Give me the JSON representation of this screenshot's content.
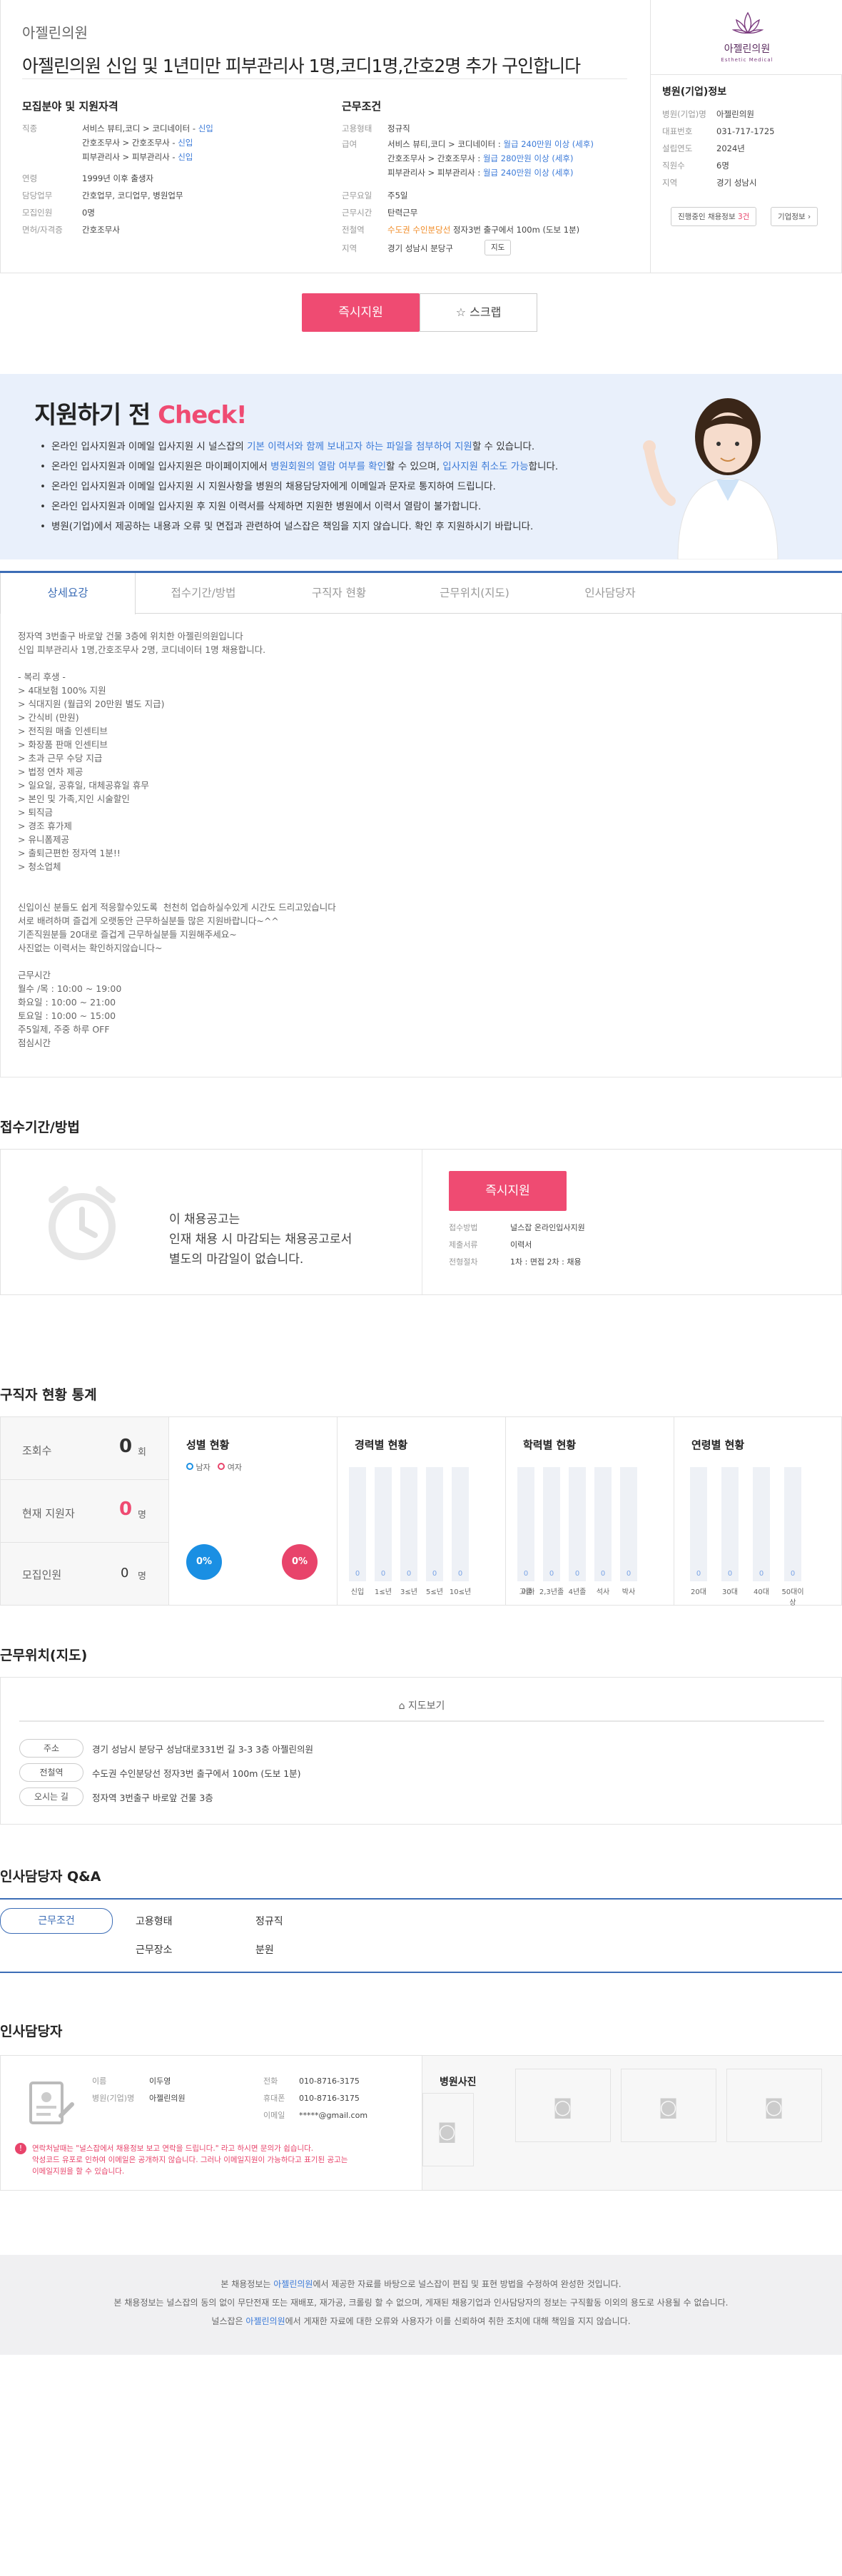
{
  "header": {
    "clinic": "아젤린의원",
    "title": "아젤린의원 신입 및 1년미만 피부관리사 1명,코디1명,간호2명 추가 구인합니다",
    "recruit_title": "모집분야 및 지원자격",
    "job_label": "직종",
    "job_lines": [
      {
        "text": "서비스 뷰티,코디 > 코디네이터 - ",
        "tag": "신입"
      },
      {
        "text": "간호조무사 > 간호조무사 - ",
        "tag": "신입"
      },
      {
        "text": "피부관리사 > 피부관리사 - ",
        "tag": "신입"
      }
    ],
    "age_label": "연령",
    "age_value": "1999년 이후 출생자",
    "duty_label": "담당업무",
    "duty_value": "간호업무, 코디업무, 병원업무",
    "count_label": "모집인원",
    "count_value": "0명",
    "license_label": "면허/자격증",
    "license_value": "간호조무사",
    "cond_title": "근무조건",
    "emp_label": "고용형태",
    "emp_value": "정규직",
    "pay_label": "급여",
    "pay_lines": [
      {
        "text": "서비스 뷰티,코디 > 코디네이터 : ",
        "amt": "월급 240만원 이상 (세후)"
      },
      {
        "text": "간호조무사 > 간호조무사 : ",
        "amt": "월급 280만원 이상 (세후)"
      },
      {
        "text": "피부관리사 > 피부관리사 : ",
        "amt": "월급 240만원 이상 (세후)"
      }
    ],
    "days_label": "근무요일",
    "days_value": "주5일",
    "hours_label": "근무시간",
    "hours_value": "탄력근무",
    "subway_label": "전철역",
    "subway_line": "수도권 수인분당선",
    "subway_value": "정자3번 출구에서 100m (도보 1분)",
    "area_label": "지역",
    "area_value": "경기 성남시 분당구",
    "map_btn": "지도"
  },
  "hospital": {
    "logo_text": "아젤린의원",
    "logo_sub": "Esthetic Medical",
    "title": "병원(기업)정보",
    "rows": [
      {
        "k": "병원(기업)명",
        "v": "아젤린의원"
      },
      {
        "k": "대표번호",
        "v": "031-717-1725"
      },
      {
        "k": "설립연도",
        "v": "2024년"
      },
      {
        "k": "직원수",
        "v": "6명"
      },
      {
        "k": "지역",
        "v": "경기 성남시"
      }
    ],
    "ongoing_prefix": "진행중인 채용정보 ",
    "ongoing_count": "3건",
    "info_btn": "기업정보 ›"
  },
  "actions": {
    "apply": "즉시지원",
    "scrap": "스크랩"
  },
  "banner": {
    "title1": "지원하기 전 ",
    "title2": "Check!",
    "items": [
      {
        "a": "온라인 입사지원과 이메일 입사지원 시 널스잡의 ",
        "b": "기본 이력서와 함께 보내고자 하는 파일을 첨부하여 지원",
        "c": "할 수 있습니다."
      },
      {
        "a": "온라인 입사지원과 이메일 입사지원은 마이페이지에서 ",
        "b": "병원회원의 열람 여부를 확인",
        "c": "할 수 있으며, ",
        "d": "입사지원 취소도 가능",
        "e": "합니다."
      },
      {
        "a": "온라인 입사지원과 이메일 입사지원 시 지원사항을 병원의 채용담당자에게 이메일과 문자로 통지하여 드립니다.",
        "b": "",
        "c": ""
      },
      {
        "a": "온라인 입사지원과 이메일 입사지원 후 지원 이력서를 삭제하면 지원한 병원에서 이력서 열람이 불가합니다.",
        "b": "",
        "c": ""
      },
      {
        "a": "병원(기업)에서 제공하는 내용과 오류 및 면접과 관련하여 널스잡은 책임을 지지 않습니다. 확인 후 지원하시기 바랍니다.",
        "b": "",
        "c": ""
      }
    ]
  },
  "tabs": [
    "상세요강",
    "접수기간/방법",
    "구직자 현황",
    "근무위치(지도)",
    "인사담당자"
  ],
  "detail_text": "정자역 3번출구 바로앞 건물 3층에 위치한 아젤린의원입니다\n신입 피부관리사 1명,간호조무사 2명, 코디네이터 1명 채용합니다.\n\n- 복리 후생 -\n> 4대보험 100% 지원\n> 식대지원 (월급외 20만원 별도 지급)\n> 간식비 (만원)\n> 전직원 매출 인센티브\n> 화장품 판매 인센티브\n> 초과 근무 수당 지급\n> 법정 연차 제공\n> 일요일, 공휴일, 대체공휴일 휴무\n> 본인 및 가족,지인 시술할인\n> 퇴직금\n> 경조 휴가제\n> 유니폼제공\n> 출퇴근편한 정자역 1분!!\n> 청소업체\n\n\n신입이신 분들도 쉽게 적응할수있도록  천천히 업습하실수있게 시간도 드리고있습니다\n서로 배려하며 즐겁게 오랫동안 근무하실분들 많은 지원바랍니다~^^\n기존직원분들 20대로 즐겁게 근무하실분들 지원해주세요~\n사진없는 이력서는 확인하지않습니다~\n\n근무시간\n월수 /목 : 10:00 ~ 19:00\n화요일 : 10:00 ~ 21:00\n토요일 : 10:00 ~ 15:00\n주5일제, 주중 하루 OFF\n점심시간",
  "reception": {
    "title": "접수기간/방법",
    "msg1": "이 채용공고는",
    "msg2": "인재 채용 시 마감되는 채용공고로서",
    "msg3": "별도의 마감일이 없습니다.",
    "apply": "즉시지원",
    "rows": [
      {
        "k": "접수방법",
        "v": "널스잡 온라인입사지원"
      },
      {
        "k": "제출서류",
        "v": "이력서"
      },
      {
        "k": "전형절차",
        "v": "1차 : 면접   2차 : 채용"
      }
    ]
  },
  "stats": {
    "title": "구직자 현황 통계",
    "views_label": "조회수",
    "views": "0",
    "views_unit": "회",
    "applicants_label": "현재 지원자",
    "applicants": "0",
    "applicants_unit": "명",
    "recruit_label": "모집인원",
    "recruit": "0",
    "recruit_unit": "명",
    "gender_title": "성별 현황",
    "male": "남자",
    "female": "여자",
    "male_pct": "0%",
    "female_pct": "0%",
    "career_title": "경력별 현황",
    "career_labels": [
      "신입",
      "1≤년",
      "3≤년",
      "5≤년",
      "10≤년"
    ],
    "career_values": [
      "0",
      "0",
      "0",
      "0",
      "0"
    ],
    "edu_title": "학력별 현황",
    "edu_labels": [
      "고졸",
      "2,3년졸",
      "4년졸",
      "석사",
      "박사"
    ],
    "edu_values": [
      "0",
      "0",
      "0",
      "0",
      "0"
    ],
    "edu_sub": "이하",
    "age_title": "연령별 현황",
    "age_labels": [
      "20대",
      "30대",
      "40대",
      "50대이상"
    ],
    "age_values": [
      "0",
      "0",
      "0",
      "0"
    ]
  },
  "location": {
    "title": "근무위치(지도)",
    "map_btn": "지도보기",
    "rows": [
      {
        "k": "주소",
        "v": "경기 성남시 분당구 성남대로331번 길 3-3 3층 아젤린의원"
      },
      {
        "k": "전철역",
        "v": "수도권 수인분당선 정자3번 출구에서 100m (도보 1분)"
      },
      {
        "k": "오시는 길",
        "v": "정자역 3번출구 바로앞 건물 3층"
      }
    ]
  },
  "qa": {
    "title": "인사담당자 Q&A",
    "tabs": [
      "근무조건",
      "고용형태",
      "정규직",
      "근무장소",
      "분원"
    ]
  },
  "manager": {
    "title": "인사담당자",
    "rows_l": [
      {
        "k": "이름",
        "v": "이두영"
      },
      {
        "k": "병원(기업)명",
        "v": "아젤린의원"
      }
    ],
    "rows_r": [
      {
        "k": "전화",
        "v": "010-8716-3175"
      },
      {
        "k": "휴대폰",
        "v": "010-8716-3175"
      },
      {
        "k": "이메일",
        "v": "*****@gmail.com"
      }
    ],
    "warn1": "연락처날때는 \"널스잡에서 채용정보 보고 연락을 드립니다.\" 라고 하시면 문의가 쉽습니다.",
    "warn2": "악성코드 유포로 인하여 이메일은 공개하지 않습니다. 그러나 이메일지원이 가능하다고 표기된 공고는",
    "warn3": "이메일지원을 할 수 있습니다.",
    "photo_title": "병원사진"
  },
  "footer": {
    "l1a": "본 채용정보는 ",
    "l1b": "아젤린의원",
    "l1c": "에서 제공한 자료를 바탕으로 널스잡이 편집 및 표현 방법을 수정하여 완성한 것입니다.",
    "l2": "본 채용정보는 널스잡의 동의 없이 무단전재 또는 재배포, 재가공, 크롤링 할 수 없으며, 게재된 채용기업과 인사담당자의 정보는 구직활동 이외의 용도로 사용될 수 없습니다.",
    "l3a": "널스잡은 ",
    "l3b": "아젤린의원",
    "l3c": "에서 게재한 자료에 대한 오류와 사용자가 이를 신뢰하여 취한 조치에 대해 책임을 지지 않습니다."
  }
}
